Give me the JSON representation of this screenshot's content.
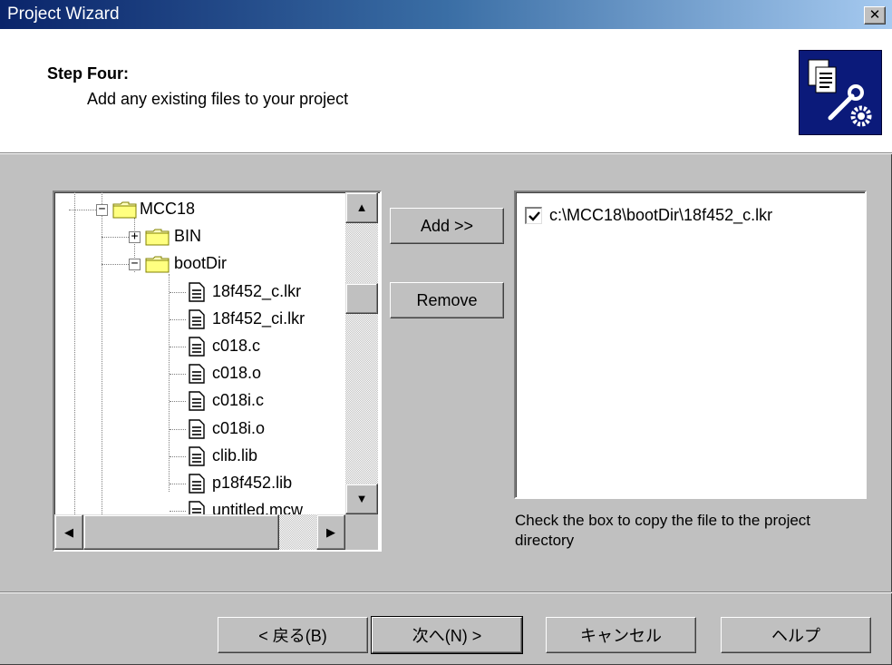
{
  "window": {
    "title": "Project Wizard",
    "close_glyph": "✕"
  },
  "header": {
    "step_title": "Step Four:",
    "step_description": "Add any existing files to your project",
    "icon": "project-wizard-tools-icon"
  },
  "tree": {
    "items": [
      {
        "label": "MCC18",
        "type": "folder",
        "expander": "−"
      },
      {
        "label": "BIN",
        "type": "folder",
        "expander": "+"
      },
      {
        "label": "bootDir",
        "type": "folder",
        "expander": "−"
      },
      {
        "label": "18f452_c.lkr",
        "type": "file"
      },
      {
        "label": "18f452_ci.lkr",
        "type": "file"
      },
      {
        "label": "c018.c",
        "type": "file"
      },
      {
        "label": "c018.o",
        "type": "file"
      },
      {
        "label": "c018i.c",
        "type": "file"
      },
      {
        "label": "c018i.o",
        "type": "file"
      },
      {
        "label": "clib.lib",
        "type": "file"
      },
      {
        "label": "p18f452.lib",
        "type": "file"
      },
      {
        "label": "untitled.mcw",
        "type": "file"
      }
    ],
    "scroll_up": "▲",
    "scroll_down": "▼",
    "scroll_left": "◀",
    "scroll_right": "▶"
  },
  "buttons": {
    "add": "Add >>",
    "remove": "Remove"
  },
  "file_list": {
    "items": [
      {
        "label": "c:\\MCC18\\bootDir\\18f452_c.lkr",
        "checked": true
      }
    ]
  },
  "hint": "Check the box to copy the file to the project directory",
  "footer": {
    "back": "< 戻る(B)",
    "next": "次へ(N) >",
    "cancel": "キャンセル",
    "help": "ヘルプ"
  }
}
